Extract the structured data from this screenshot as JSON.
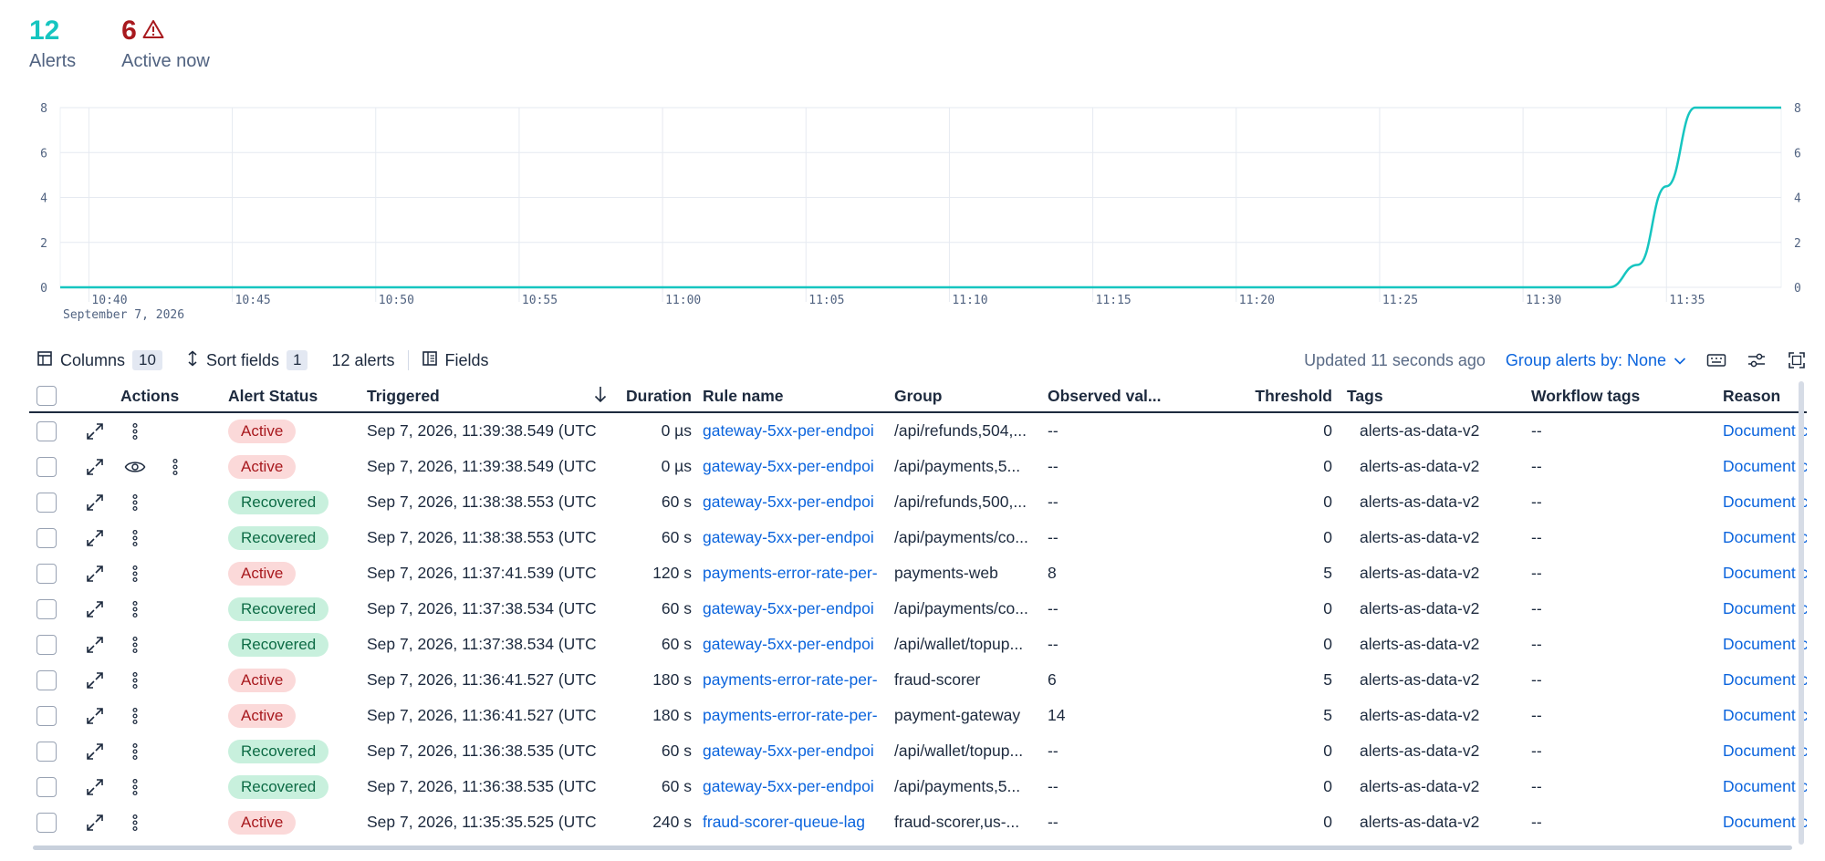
{
  "summary": {
    "alerts_count": "12",
    "alerts_label": "Alerts",
    "active_count": "6",
    "active_label": "Active now"
  },
  "chart_data": {
    "type": "line",
    "x_ticks": [
      "10:40",
      "10:45",
      "10:50",
      "10:55",
      "11:00",
      "11:05",
      "11:10",
      "11:15",
      "11:20",
      "11:25",
      "11:30",
      "11:35"
    ],
    "x_sublabel": "September 7, 2026",
    "y_ticks": [
      0,
      2,
      4,
      6,
      8
    ],
    "ylim": [
      0,
      8
    ],
    "xlim": [
      "10:39",
      "11:39"
    ],
    "grid": true,
    "series": [
      {
        "color": "#16c5c0",
        "points": [
          [
            "10:39",
            0
          ],
          [
            "11:33",
            0
          ],
          [
            "11:34",
            1
          ],
          [
            "11:35",
            4.5
          ],
          [
            "11:36",
            8
          ],
          [
            "11:39",
            8
          ]
        ]
      }
    ]
  },
  "toolbar": {
    "columns_label": "Columns",
    "columns_count": "10",
    "sort_label": "Sort fields",
    "sort_count": "1",
    "alerts_count_label": "12 alerts",
    "fields_label": "Fields",
    "updated_label": "Updated 11 seconds ago",
    "group_by_label": "Group alerts by: None"
  },
  "table": {
    "headers": {
      "actions": "Actions",
      "status": "Alert Status",
      "triggered": "Triggered",
      "duration": "Duration",
      "rule": "Rule name",
      "group": "Group",
      "observed": "Observed val...",
      "threshold": "Threshold",
      "tags": "Tags",
      "workflow_tags": "Workflow tags",
      "reason": "Reason"
    },
    "rows": [
      {
        "status": "Active",
        "triggered": "Sep 7, 2026, 11:39:38.549 (UTC",
        "duration": "0 µs",
        "rule": "gateway-5xx-per-endpoi",
        "group": "/api/refunds,504,...",
        "observed": "--",
        "threshold": "0",
        "tags": "alerts-as-data-v2",
        "workflow": "--",
        "reason": "Document count"
      },
      {
        "status": "Active",
        "triggered": "Sep 7, 2026, 11:39:38.549 (UTC",
        "duration": "0 µs",
        "rule": "gateway-5xx-per-endpoi",
        "group": "/api/payments,5...",
        "observed": "--",
        "threshold": "0",
        "tags": "alerts-as-data-v2",
        "workflow": "--",
        "reason": "Document count"
      },
      {
        "status": "Recovered",
        "triggered": "Sep 7, 2026, 11:38:38.553 (UTC",
        "duration": "60 s",
        "rule": "gateway-5xx-per-endpoi",
        "group": "/api/refunds,500,...",
        "observed": "--",
        "threshold": "0",
        "tags": "alerts-as-data-v2",
        "workflow": "--",
        "reason": "Document count"
      },
      {
        "status": "Recovered",
        "triggered": "Sep 7, 2026, 11:38:38.553 (UTC",
        "duration": "60 s",
        "rule": "gateway-5xx-per-endpoi",
        "group": "/api/payments/co...",
        "observed": "--",
        "threshold": "0",
        "tags": "alerts-as-data-v2",
        "workflow": "--",
        "reason": "Document count"
      },
      {
        "status": "Active",
        "triggered": "Sep 7, 2026, 11:37:41.539 (UTC",
        "duration": "120 s",
        "rule": "payments-error-rate-per-",
        "group": "payments-web",
        "observed": "8",
        "threshold": "5",
        "tags": "alerts-as-data-v2",
        "workflow": "--",
        "reason": "Document count"
      },
      {
        "status": "Recovered",
        "triggered": "Sep 7, 2026, 11:37:38.534 (UTC",
        "duration": "60 s",
        "rule": "gateway-5xx-per-endpoi",
        "group": "/api/payments/co...",
        "observed": "--",
        "threshold": "0",
        "tags": "alerts-as-data-v2",
        "workflow": "--",
        "reason": "Document count"
      },
      {
        "status": "Recovered",
        "triggered": "Sep 7, 2026, 11:37:38.534 (UTC",
        "duration": "60 s",
        "rule": "gateway-5xx-per-endpoi",
        "group": "/api/wallet/topup...",
        "observed": "--",
        "threshold": "0",
        "tags": "alerts-as-data-v2",
        "workflow": "--",
        "reason": "Document count"
      },
      {
        "status": "Active",
        "triggered": "Sep 7, 2026, 11:36:41.527 (UTC",
        "duration": "180 s",
        "rule": "payments-error-rate-per-",
        "group": "fraud-scorer",
        "observed": "6",
        "threshold": "5",
        "tags": "alerts-as-data-v2",
        "workflow": "--",
        "reason": "Document count"
      },
      {
        "status": "Active",
        "triggered": "Sep 7, 2026, 11:36:41.527 (UTC",
        "duration": "180 s",
        "rule": "payments-error-rate-per-",
        "group": "payment-gateway",
        "observed": "14",
        "threshold": "5",
        "tags": "alerts-as-data-v2",
        "workflow": "--",
        "reason": "Document count"
      },
      {
        "status": "Recovered",
        "triggered": "Sep 7, 2026, 11:36:38.535 (UTC",
        "duration": "60 s",
        "rule": "gateway-5xx-per-endpoi",
        "group": "/api/wallet/topup...",
        "observed": "--",
        "threshold": "0",
        "tags": "alerts-as-data-v2",
        "workflow": "--",
        "reason": "Document count"
      },
      {
        "status": "Recovered",
        "triggered": "Sep 7, 2026, 11:36:38.535 (UTC",
        "duration": "60 s",
        "rule": "gateway-5xx-per-endpoi",
        "group": "/api/payments,5...",
        "observed": "--",
        "threshold": "0",
        "tags": "alerts-as-data-v2",
        "workflow": "--",
        "reason": "Document count"
      },
      {
        "status": "Active",
        "triggered": "Sep 7, 2026, 11:35:35.525 (UTC",
        "duration": "240 s",
        "rule": "fraud-scorer-queue-lag",
        "group": "fraud-scorer,us-...",
        "observed": "--",
        "threshold": "0",
        "tags": "alerts-as-data-v2",
        "workflow": "--",
        "reason": "Document count"
      }
    ]
  },
  "colors": {
    "accent_teal": "#16c5c0",
    "danger": "#a8191e",
    "link": "#0b64dd",
    "recovered": "#0d6b45"
  }
}
